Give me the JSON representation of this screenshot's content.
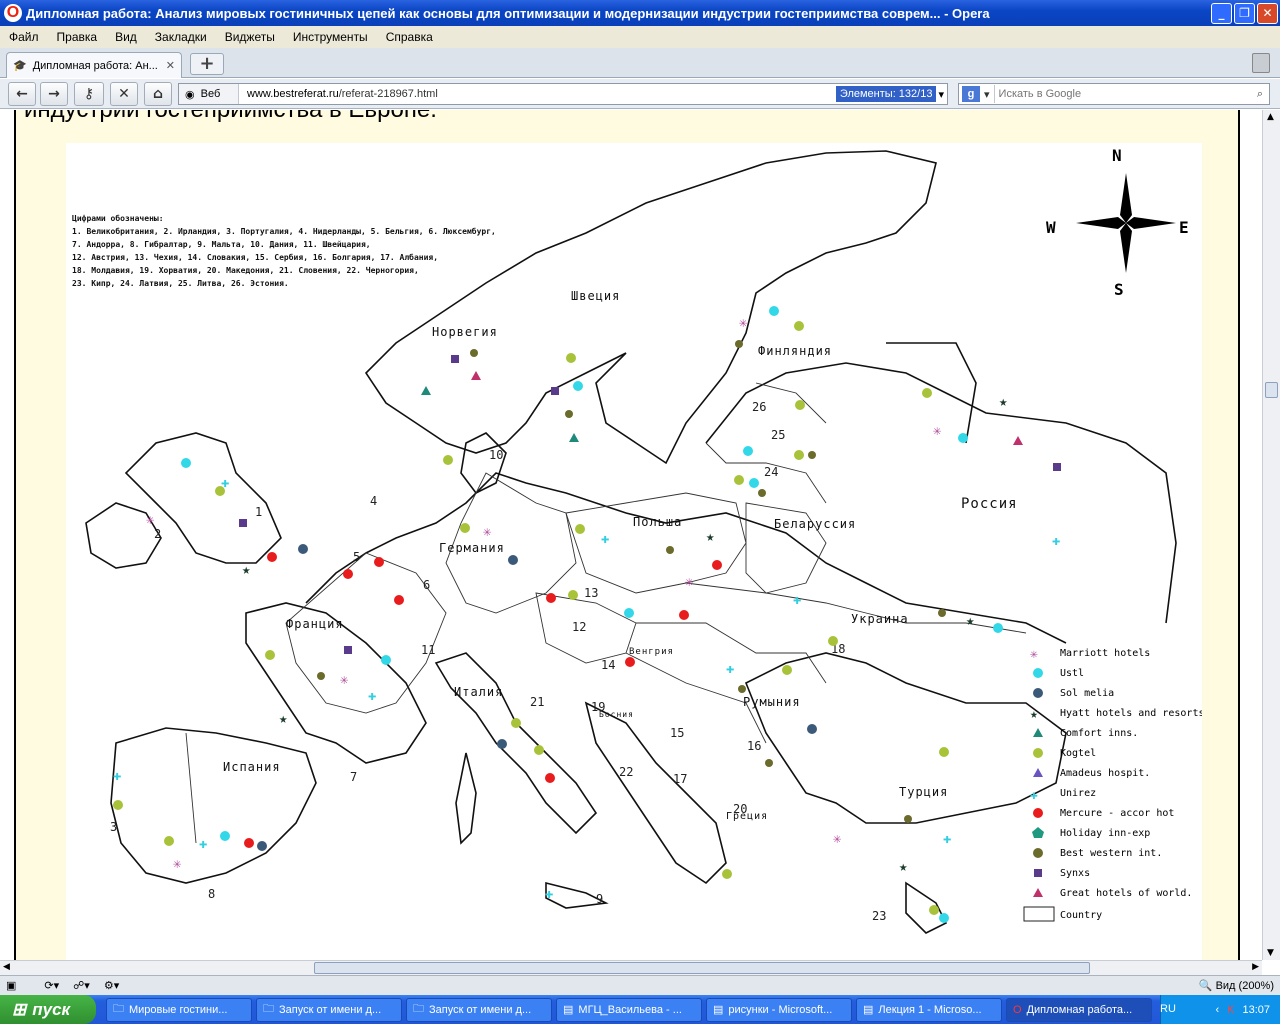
{
  "window": {
    "title": "Дипломная работа: Анализ мировых гостиничных цепей как основы для оптимизации и модернизации индустрии гостеприимства соврем... - Opera"
  },
  "menu": [
    "Файл",
    "Правка",
    "Вид",
    "Закладки",
    "Виджеты",
    "Инструменты",
    "Справка"
  ],
  "tab": {
    "label": "Дипломная работа: Ан..."
  },
  "address": {
    "web_label": "Веб",
    "url_host": "www.bestreferat.ru",
    "url_path": "/referat-218967.html",
    "elements": "Элементы:  132/13"
  },
  "search": {
    "placeholder": "Искать в Google"
  },
  "page": {
    "heading_fragment": "индустрии гостеприимства в Европе."
  },
  "map": {
    "legend_heading": "Цифрами обозначены:",
    "legend_lines": [
      "1. Великобритания, 2. Ирландия, 3. Португалия, 4. Нидерланды, 5. Бельгия, 6. Люксембург,",
      "7. Андорра, 8. Гибралтар, 9. Мальта, 10. Дания, 11. Швейцария,",
      "12. Австрия, 13. Чехия, 14. Словакия, 15. Сербия, 16. Болгария, 17. Албания,",
      "18. Молдавия, 19. Хорватия, 20. Македония, 21. Словения, 22. Черногория,",
      "23. Кипр, 24. Латвия, 25. Литва, 26. Эстония."
    ],
    "compass": {
      "n": "N",
      "s": "S",
      "w": "W",
      "e": "E"
    },
    "countries": [
      "Норвегия",
      "Швеция",
      "Финляндия",
      "Россия",
      "Беларуссия",
      "Польша",
      "Германия",
      "Франция",
      "Испания",
      "Италия",
      "Украина",
      "Румыния",
      "Турция",
      "Греция",
      "Венгрия",
      "Босния"
    ],
    "numbers": [
      "1",
      "2",
      "3",
      "4",
      "5",
      "6",
      "7",
      "8",
      "9",
      "10",
      "11",
      "12",
      "13",
      "14",
      "15",
      "16",
      "17",
      "18",
      "19",
      "20",
      "21",
      "22",
      "23",
      "24",
      "25",
      "26"
    ],
    "hotel_legend": [
      {
        "label": "Marriott hotels",
        "shape": "asterisk",
        "color": "#b04a9a"
      },
      {
        "label": "Ustl",
        "shape": "star",
        "color": "#33d8e8"
      },
      {
        "label": "Sol melia",
        "shape": "circle",
        "color": "#3b5a7a"
      },
      {
        "label": "Hyatt hotels and resorts.",
        "shape": "star",
        "color": "#1b3b2b"
      },
      {
        "label": "Comfort inns.",
        "shape": "triangle",
        "color": "#1f8a7a"
      },
      {
        "label": "Kogtel",
        "shape": "circle",
        "color": "#a8c23a"
      },
      {
        "label": "Amadeus hospit.",
        "shape": "triangle",
        "color": "#6a55c0"
      },
      {
        "label": "Unirez",
        "shape": "plus",
        "color": "#33cfe0"
      },
      {
        "label": "Mercure - accor hot",
        "shape": "circle",
        "color": "#e81c1c"
      },
      {
        "label": "Holiday inn-exp",
        "shape": "pentagon",
        "color": "#1f9a80"
      },
      {
        "label": "Best western int.",
        "shape": "circle",
        "color": "#6b6b2c"
      },
      {
        "label": "Synxs",
        "shape": "square",
        "color": "#5a3a8a"
      },
      {
        "label": "Great hotels of world.",
        "shape": "triangle",
        "color": "#c0306a"
      },
      {
        "label": "Country",
        "shape": "rect",
        "color": "#ffffff"
      }
    ]
  },
  "status": {
    "zoom": "Вид (200%)"
  },
  "taskbar": {
    "start": "пуск",
    "tasks": [
      "Мировые гостини...",
      "Запуск от имени д...",
      "Запуск от имени д...",
      "МГЦ_Васильева - ...",
      "рисунки - Microsoft...",
      "Лекция 1 - Microso...",
      "Дипломная работа..."
    ],
    "lang": "RU",
    "clock": "13:07"
  }
}
